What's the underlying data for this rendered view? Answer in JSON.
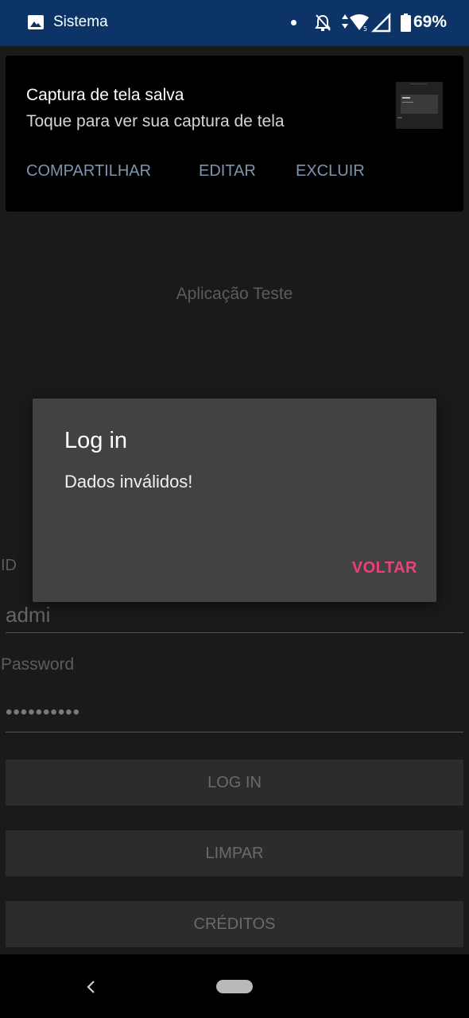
{
  "status_bar": {
    "app_label": "Sistema",
    "battery": "69%",
    "background": "#0c3466"
  },
  "notification": {
    "title": "Captura de tela salva",
    "text": "Toque para ver sua captura de tela",
    "actions": [
      "COMPARTILHAR",
      "EDITAR",
      "EXCLUIR"
    ]
  },
  "app": {
    "title": "Aplicação Teste",
    "id_label": "ID",
    "id_value": "admi",
    "password_label": "Password",
    "password_value": "••••••••••",
    "buttons": {
      "login": "LOG IN",
      "clear": "LIMPAR",
      "credits": "CRÉDITOS"
    }
  },
  "dialog": {
    "title": "Log in",
    "message": "Dados inválidos!",
    "button": "VOLTAR",
    "accent": "#ec407a"
  },
  "icons": [
    "image-icon",
    "dnd-off-icon",
    "data-arrows-icon",
    "wifi-icon",
    "signal-icon",
    "battery-icon",
    "back-icon",
    "home-pill-icon"
  ]
}
